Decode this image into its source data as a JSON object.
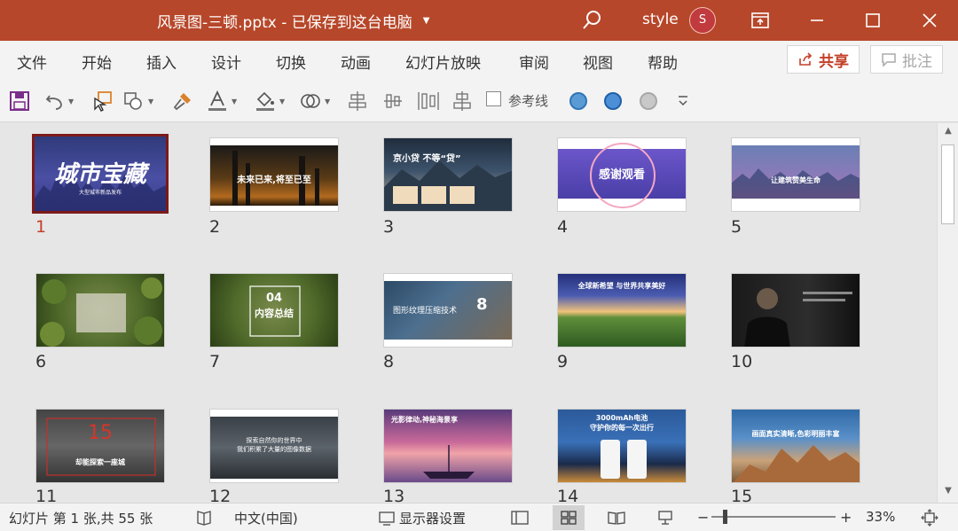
{
  "titlebar": {
    "title": "风景图-三顿.pptx  -  已保存到这台电脑",
    "user": "style",
    "avatar_initial": "S",
    "color": "#b7472a"
  },
  "menu": {
    "items": [
      "文件",
      "开始",
      "插入",
      "设计",
      "切换",
      "动画",
      "幻灯片放映",
      "审阅",
      "视图",
      "帮助"
    ],
    "share": "共享",
    "comment": "批注"
  },
  "toolbar": {
    "guides_label": "参考线",
    "icons": [
      "save-icon",
      "undo-icon",
      "select-icon",
      "shapes-icon",
      "format-painter-icon",
      "font-color-icon",
      "fill-color-icon",
      "shape-outline-icon",
      "align-left-icon",
      "distribute-h-icon",
      "distribute-v-icon",
      "align-center-icon",
      "theme-color-1",
      "theme-color-2",
      "theme-color-3",
      "more-icon"
    ]
  },
  "slides": [
    {
      "number": "1",
      "text": "城市宝藏",
      "sub": "大型城市新品发布",
      "selected": true
    },
    {
      "number": "2",
      "text": "未来已来,将至已至",
      "sub": ""
    },
    {
      "number": "3",
      "text": "京小贷 不等“贷”",
      "sub": ""
    },
    {
      "number": "4",
      "text": "感谢观看",
      "sub": ""
    },
    {
      "number": "5",
      "text": "让建筑赞美生命",
      "sub": ""
    },
    {
      "number": "6",
      "text": "",
      "sub": ""
    },
    {
      "number": "7",
      "text": "内容总结",
      "sub": "04"
    },
    {
      "number": "8",
      "text": "图形纹理压缩技术",
      "sub": "8"
    },
    {
      "number": "9",
      "text": "全球新希望 与世界共享美好",
      "sub": ""
    },
    {
      "number": "10",
      "text": "",
      "sub": ""
    },
    {
      "number": "11",
      "text": "却能探索一座城",
      "sub": "15"
    },
    {
      "number": "12",
      "text": "探索自然你的世界中",
      "sub": "我们积累了大量的图像数据"
    },
    {
      "number": "13",
      "text": "光影律动,神秘海景享",
      "sub": ""
    },
    {
      "number": "14",
      "text": "3000mAh电池",
      "sub": "守护你的每一次出行"
    },
    {
      "number": "15",
      "text": "画面真实清晰,色彩明丽丰富",
      "sub": ""
    }
  ],
  "status": {
    "slide_info": "幻灯片 第 1 张,共 55 张",
    "language": "中文(中国)",
    "display_settings": "显示器设置",
    "zoom": "33%",
    "zoom_minus": "−",
    "zoom_plus": "+"
  }
}
